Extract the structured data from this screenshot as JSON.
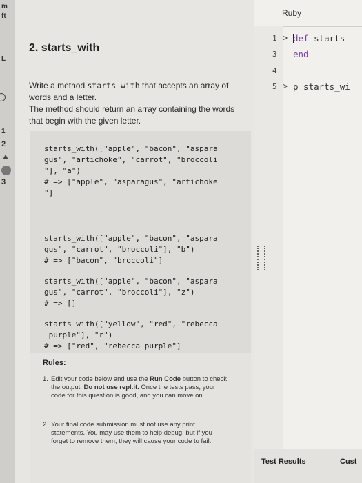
{
  "sidebar": {
    "marks": [
      "m",
      "ft",
      "L",
      "1"
    ],
    "numbers": [
      "2",
      "3"
    ]
  },
  "exercise": {
    "title": "2. starts_with",
    "description": {
      "part1": "Write a method ",
      "method_name": "starts_with",
      "part2": " that accepts an array of words and a letter.",
      "part3": "The method should return an array containing the words that begin with the given letter."
    },
    "examples": [
      "starts_with([\"apple\", \"bacon\", \"aspara\ngus\", \"artichoke\", \"carrot\", \"broccoli\n\"], \"a\")\n# => [\"apple\", \"asparagus\", \"artichoke\n\"]",
      "starts_with([\"apple\", \"bacon\", \"aspara\ngus\", \"carrot\", \"broccoli\"], \"b\")\n# => [\"bacon\", \"broccoli\"]",
      "starts_with([\"apple\", \"bacon\", \"aspara\ngus\", \"carrot\", \"broccoli\"], \"z\")\n# => []",
      "starts_with([\"yellow\", \"red\", \"rebecca\n purple\"], \"r\")\n# => [\"red\", \"rebecca purple\"]"
    ],
    "rules_title": "Rules:",
    "rules": [
      {
        "num": "1.",
        "a": "Edit your code below and use the ",
        "b": "Run Code",
        "c": " button to check the output. ",
        "d": "Do not use repl.it.",
        "e": " Once the tests pass, your code for this question is good, and you can move on."
      },
      {
        "num": "2.",
        "text": "Your final code submission must not use any print statements. You may use them to help debug, but if you forget to remove them, they will cause your code to fail."
      }
    ]
  },
  "editor": {
    "language": "Ruby",
    "lines": [
      {
        "num": "1",
        "fold": ">",
        "kw": "def",
        "rest": " starts"
      },
      {
        "num": "3",
        "fold": "",
        "kw": "end",
        "rest": ""
      },
      {
        "num": "4",
        "fold": "",
        "kw": "",
        "rest": ""
      },
      {
        "num": "5",
        "fold": ">",
        "kw": "",
        "rest": "p starts_wi"
      }
    ]
  },
  "bottom_tabs": {
    "test_results": "Test Results",
    "custom": "Cust"
  }
}
